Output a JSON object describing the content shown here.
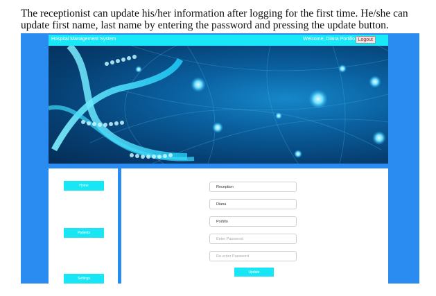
{
  "caption": "The receptionist can update his/her information after logging for the first time. He/she can update first name, last name by entering the password and pressing the update button.",
  "header": {
    "app_title": "Hospital Management System",
    "welcome": "Welcome, Diana Portillo",
    "logout_label": "Logout"
  },
  "sidebar": {
    "items": [
      {
        "label": "Home"
      },
      {
        "label": "Patients"
      },
      {
        "label": "Settings"
      }
    ]
  },
  "form": {
    "role_value": "Reception",
    "first_name_value": "Diana",
    "last_name_value": "Portillo",
    "password_placeholder": "Enter Password",
    "confirm_placeholder": "Re-enter Password",
    "update_label": "Update"
  },
  "colors": {
    "page_blue": "#2a8cf0",
    "accent_cyan": "#19e6f5",
    "logout_text": "#b31b1b"
  }
}
